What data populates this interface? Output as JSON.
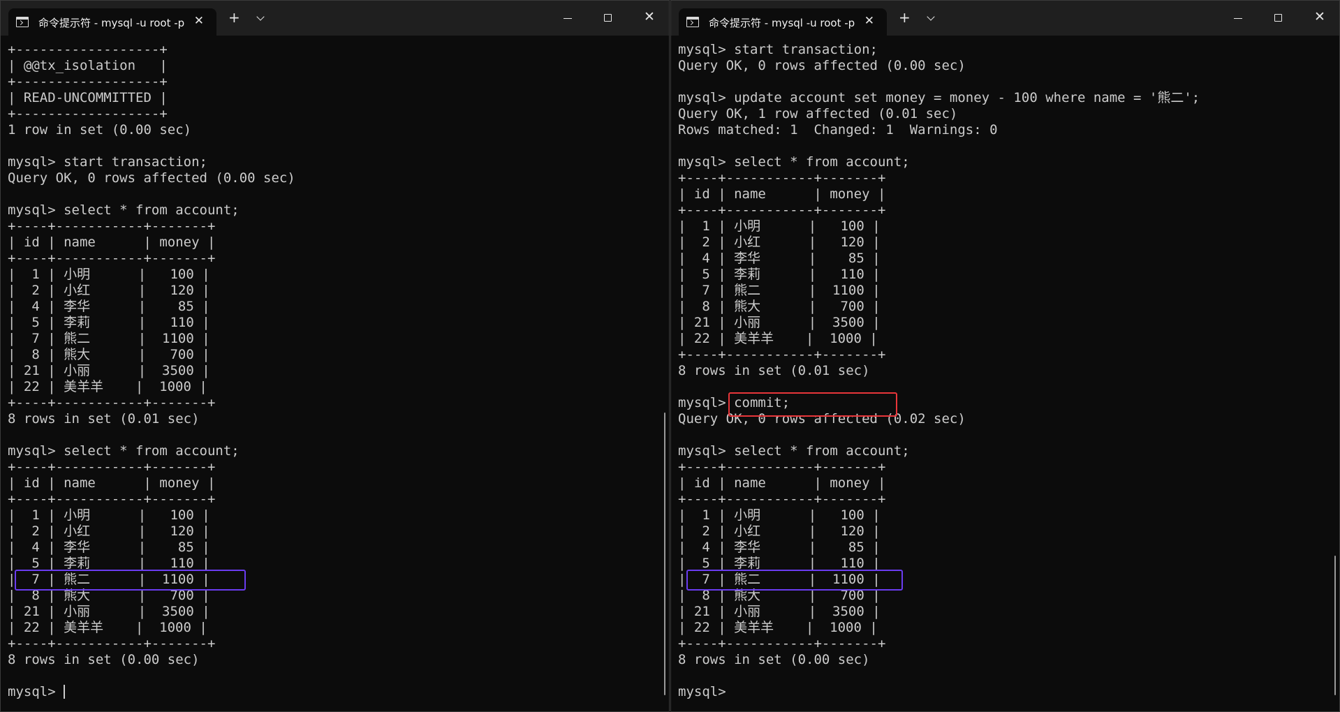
{
  "windows": [
    {
      "tab_title": "命令提示符 - mysql  -u root -p",
      "new_tab_label": "+",
      "lines": [
        "+------------------+",
        "| @@tx_isolation   |",
        "+------------------+",
        "| READ-UNCOMMITTED |",
        "+------------------+",
        "1 row in set (0.00 sec)",
        "",
        "mysql> start transaction;",
        "Query OK, 0 rows affected (0.00 sec)",
        "",
        "mysql> select * from account;",
        "+----+-----------+-------+",
        "| id | name      | money |",
        "+----+-----------+-------+",
        "|  1 | 小明      |   100 |",
        "|  2 | 小红      |   120 |",
        "|  4 | 李华      |    85 |",
        "|  5 | 李莉      |   110 |",
        "|  7 | 熊二      |  1100 |",
        "|  8 | 熊大      |   700 |",
        "| 21 | 小丽      |  3500 |",
        "| 22 | 美羊羊    |  1000 |",
        "+----+-----------+-------+",
        "8 rows in set (0.01 sec)",
        "",
        "mysql> select * from account;",
        "+----+-----------+-------+",
        "| id | name      | money |",
        "+----+-----------+-------+",
        "|  1 | 小明      |   100 |",
        "|  2 | 小红      |   120 |",
        "|  4 | 李华      |    85 |",
        "|  5 | 李莉      |   110 |",
        "|  7 | 熊二      |  1100 |",
        "|  8 | 熊大      |   700 |",
        "| 21 | 小丽      |  3500 |",
        "| 22 | 美羊羊    |  1000 |",
        "+----+-----------+-------+",
        "8 rows in set (0.00 sec)",
        "",
        "mysql> "
      ]
    },
    {
      "tab_title": "命令提示符 - mysql  -u root -p",
      "new_tab_label": "+",
      "lines": [
        "mysql> start transaction;",
        "Query OK, 0 rows affected (0.00 sec)",
        "",
        "mysql> update account set money = money - 100 where name = '熊二';",
        "Query OK, 1 row affected (0.01 sec)",
        "Rows matched: 1  Changed: 1  Warnings: 0",
        "",
        "mysql> select * from account;",
        "+----+-----------+-------+",
        "| id | name      | money |",
        "+----+-----------+-------+",
        "|  1 | 小明      |   100 |",
        "|  2 | 小红      |   120 |",
        "|  4 | 李华      |    85 |",
        "|  5 | 李莉      |   110 |",
        "|  7 | 熊二      |  1100 |",
        "|  8 | 熊大      |   700 |",
        "| 21 | 小丽      |  3500 |",
        "| 22 | 美羊羊    |  1000 |",
        "+----+-----------+-------+",
        "8 rows in set (0.01 sec)",
        "",
        "mysql> commit;",
        "Query OK, 0 rows affected (0.02 sec)",
        "",
        "mysql> select * from account;",
        "+----+-----------+-------+",
        "| id | name      | money |",
        "+----+-----------+-------+",
        "|  1 | 小明      |   100 |",
        "|  2 | 小红      |   120 |",
        "|  4 | 李华      |    85 |",
        "|  5 | 李莉      |   110 |",
        "|  7 | 熊二      |  1100 |",
        "|  8 | 熊大      |   700 |",
        "| 21 | 小丽      |  3500 |",
        "| 22 | 美羊羊    |  1000 |",
        "+----+-----------+-------+",
        "8 rows in set (0.00 sec)",
        "",
        "mysql> "
      ]
    }
  ],
  "colors": {
    "terminal_bg": "#0c0c0c",
    "terminal_fg": "#cccccc",
    "titlebar_bg": "#1f1f1f",
    "highlight_red": "#e8363a",
    "highlight_purple": "#6a3cf0"
  },
  "icons": [
    "terminal-icon",
    "close-icon",
    "plus-icon",
    "chevron-down-icon",
    "minimize-icon",
    "maximize-icon",
    "window-close-icon"
  ]
}
